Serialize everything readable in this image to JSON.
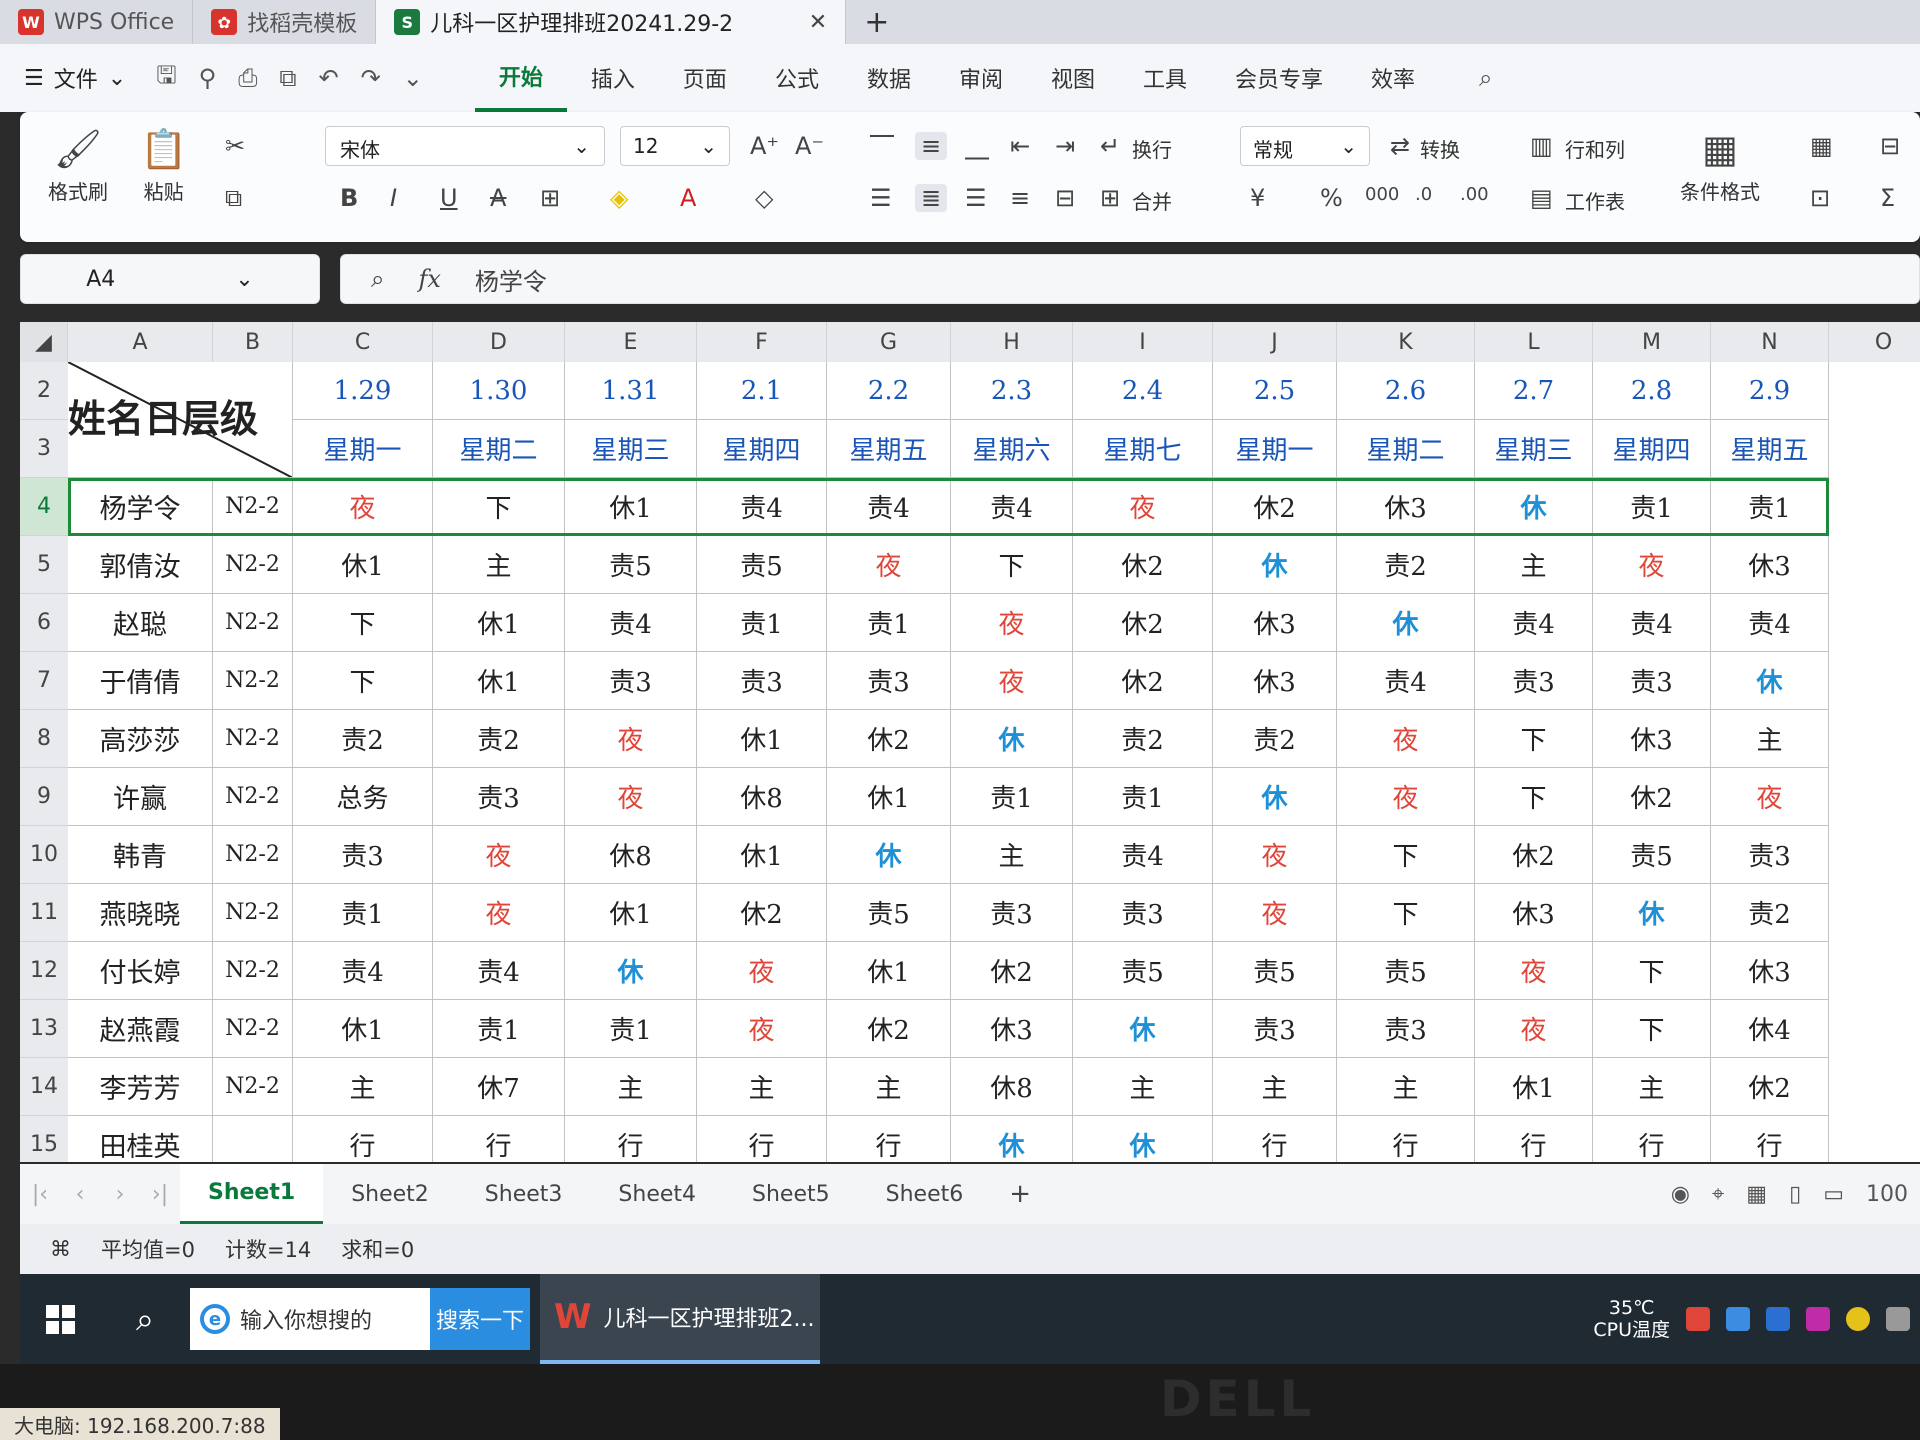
{
  "tabs": [
    {
      "label": "WPS Office",
      "icon_color": "#d6342c"
    },
    {
      "label": "找稻壳模板",
      "icon_color": "#d6342c"
    },
    {
      "label": "儿科一区护理排班20241.29-2",
      "icon_color": "#1b7a3e"
    }
  ],
  "menu": {
    "file": "文件",
    "items": [
      "开始",
      "插入",
      "页面",
      "公式",
      "数据",
      "审阅",
      "视图",
      "工具",
      "会员专享",
      "效率"
    ]
  },
  "ribbon": {
    "format_painter": "格式刷",
    "paste": "粘贴",
    "font_name": "宋体",
    "font_size": "12",
    "wrap": "换行",
    "merge": "合并",
    "number_format": "常规",
    "convert": "转换",
    "rows_cols": "行和列",
    "worksheet": "工作表",
    "cond_format": "条件格式"
  },
  "formula_bar": {
    "cell_ref": "A4",
    "fx": "fx",
    "value": "杨学令"
  },
  "columns": [
    "A",
    "B",
    "C",
    "D",
    "E",
    "F",
    "G",
    "H",
    "I",
    "J",
    "K",
    "L",
    "M",
    "N",
    "O"
  ],
  "rows": [
    "2",
    "3",
    "4",
    "5",
    "6",
    "7",
    "8",
    "9",
    "10",
    "11",
    "12",
    "13",
    "14",
    "15"
  ],
  "table": {
    "corner_label": "姓名日层级",
    "dates": [
      "1.29",
      "1.30",
      "1.31",
      "2.1",
      "2.2",
      "2.3",
      "2.4",
      "2.5",
      "2.6",
      "2.7",
      "2.8",
      "2.9"
    ],
    "weekdays": [
      "星期一",
      "星期二",
      "星期三",
      "星期四",
      "星期五",
      "星期六",
      "星期七",
      "星期一",
      "星期二",
      "星期三",
      "星期四",
      "星期五"
    ],
    "staff": [
      {
        "name": "杨学令",
        "level": "N2-2",
        "shifts": [
          "夜",
          "下",
          "休1",
          "责4",
          "责4",
          "责4",
          "夜",
          "休2",
          "休3",
          "休",
          "责1",
          "责1"
        ]
      },
      {
        "name": "郭倩汝",
        "level": "N2-2",
        "shifts": [
          "休1",
          "主",
          "责5",
          "责5",
          "夜",
          "下",
          "休2",
          "休",
          "责2",
          "主",
          "夜",
          "休3"
        ]
      },
      {
        "name": "赵聪",
        "level": "N2-2",
        "shifts": [
          "下",
          "休1",
          "责4",
          "责1",
          "责1",
          "夜",
          "休2",
          "休3",
          "休",
          "责4",
          "责4",
          "责4"
        ]
      },
      {
        "name": "于倩倩",
        "level": "N2-2",
        "shifts": [
          "下",
          "休1",
          "责3",
          "责3",
          "责3",
          "夜",
          "休2",
          "休3",
          "责4",
          "责3",
          "责3",
          "休"
        ]
      },
      {
        "name": "高莎莎",
        "level": "N2-2",
        "shifts": [
          "责2",
          "责2",
          "夜",
          "休1",
          "休2",
          "休",
          "责2",
          "责2",
          "夜",
          "下",
          "休3",
          "主"
        ]
      },
      {
        "name": "许赢",
        "level": "N2-2",
        "shifts": [
          "总务",
          "责3",
          "夜",
          "休8",
          "休1",
          "责1",
          "责1",
          "休",
          "夜",
          "下",
          "休2",
          "夜"
        ]
      },
      {
        "name": "韩青",
        "level": "N2-2",
        "shifts": [
          "责3",
          "夜",
          "休8",
          "休1",
          "休",
          "主",
          "责4",
          "夜",
          "下",
          "休2",
          "责5",
          "责3"
        ]
      },
      {
        "name": "燕晓晓",
        "level": "N2-2",
        "shifts": [
          "责1",
          "夜",
          "休1",
          "休2",
          "责5",
          "责3",
          "责3",
          "夜",
          "下",
          "休3",
          "休",
          "责2"
        ]
      },
      {
        "name": "付长婷",
        "level": "N2-2",
        "shifts": [
          "责4",
          "责4",
          "休",
          "夜",
          "休1",
          "休2",
          "责5",
          "责5",
          "责5",
          "夜",
          "下",
          "休3"
        ]
      },
      {
        "name": "赵燕霞",
        "level": "N2-2",
        "shifts": [
          "休1",
          "责1",
          "责1",
          "夜",
          "休2",
          "休3",
          "休",
          "责3",
          "责3",
          "夜",
          "下",
          "休4"
        ]
      },
      {
        "name": "李芳芳",
        "level": "N2-2",
        "shifts": [
          "主",
          "休7",
          "主",
          "主",
          "主",
          "休8",
          "主",
          "主",
          "主",
          "休1",
          "主",
          "休2"
        ]
      },
      {
        "name": "田桂英",
        "level": "",
        "shifts": [
          "行",
          "行",
          "行",
          "行",
          "行",
          "休",
          "休",
          "行",
          "行",
          "行",
          "行",
          "行"
        ]
      }
    ]
  },
  "sheet_tabs": [
    "Sheet1",
    "Sheet2",
    "Sheet3",
    "Sheet4",
    "Sheet5",
    "Sheet6"
  ],
  "status": {
    "avg": "平均值=0",
    "count": "计数=14",
    "sum": "求和=0",
    "zoom": "100"
  },
  "taskbar": {
    "search_placeholder": "输入你想搜的",
    "search_button": "搜索一下",
    "app": "儿科一区护理排班2...",
    "temp": "35℃",
    "temp_label": "CPU温度"
  },
  "bezel": {
    "brand": "DELL",
    "note": "大电脑: 192.168.200.7:88"
  },
  "colors": {
    "accent": "#0a7a3a",
    "header_text": "#1a55b8",
    "night": "#e0453a",
    "rest": "#1f8fd6"
  }
}
